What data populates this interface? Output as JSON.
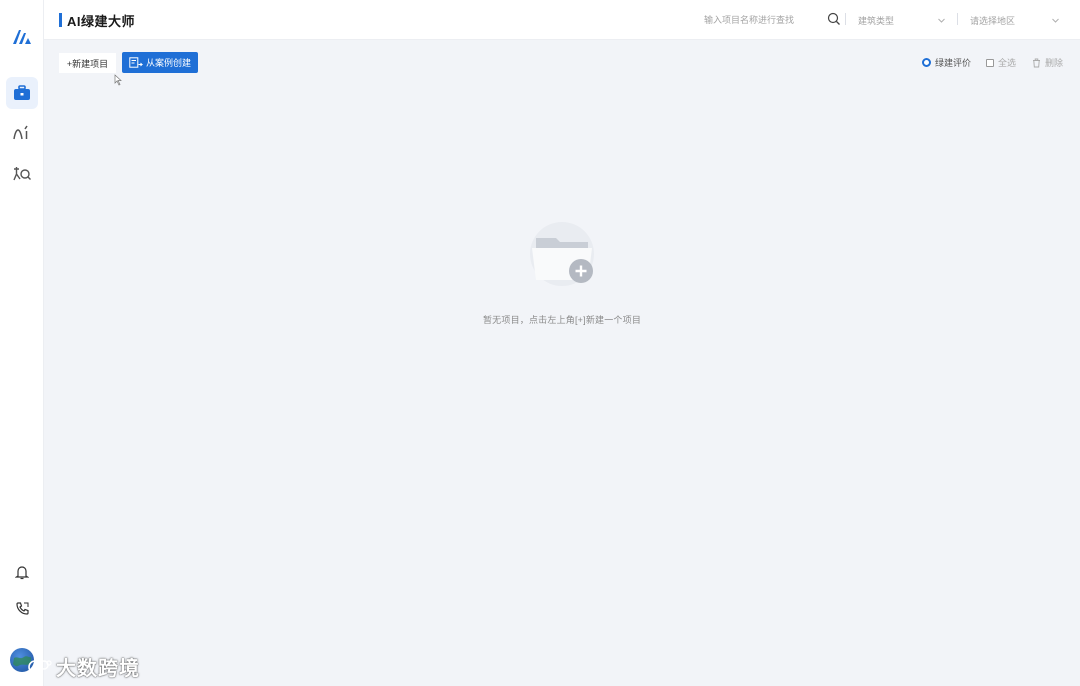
{
  "header": {
    "title": "AI绿建大师",
    "search_placeholder": "输入项目名称进行查找",
    "building_type_placeholder": "建筑类型",
    "region_placeholder": "请选择地区"
  },
  "sidebar": {
    "items": [
      {
        "icon": "briefcase-icon",
        "active": true
      },
      {
        "icon": "ai-icon",
        "active": false
      },
      {
        "icon": "knowledge-search-icon",
        "active": false
      }
    ],
    "bottom": [
      {
        "icon": "bell-icon"
      },
      {
        "icon": "phone-icon"
      }
    ]
  },
  "toolbar": {
    "new_project_label": "+新建项目",
    "from_case_label": "从案例创建",
    "green_eval_label": "绿建评价",
    "select_all_label": "全选",
    "delete_label": "删除"
  },
  "empty_state": {
    "message": "暂无项目，点击左上角[+]新建一个项目"
  },
  "watermark": {
    "text": "大数跨境"
  },
  "colors": {
    "accent": "#1f6fd6",
    "background": "#f2f4f8"
  }
}
